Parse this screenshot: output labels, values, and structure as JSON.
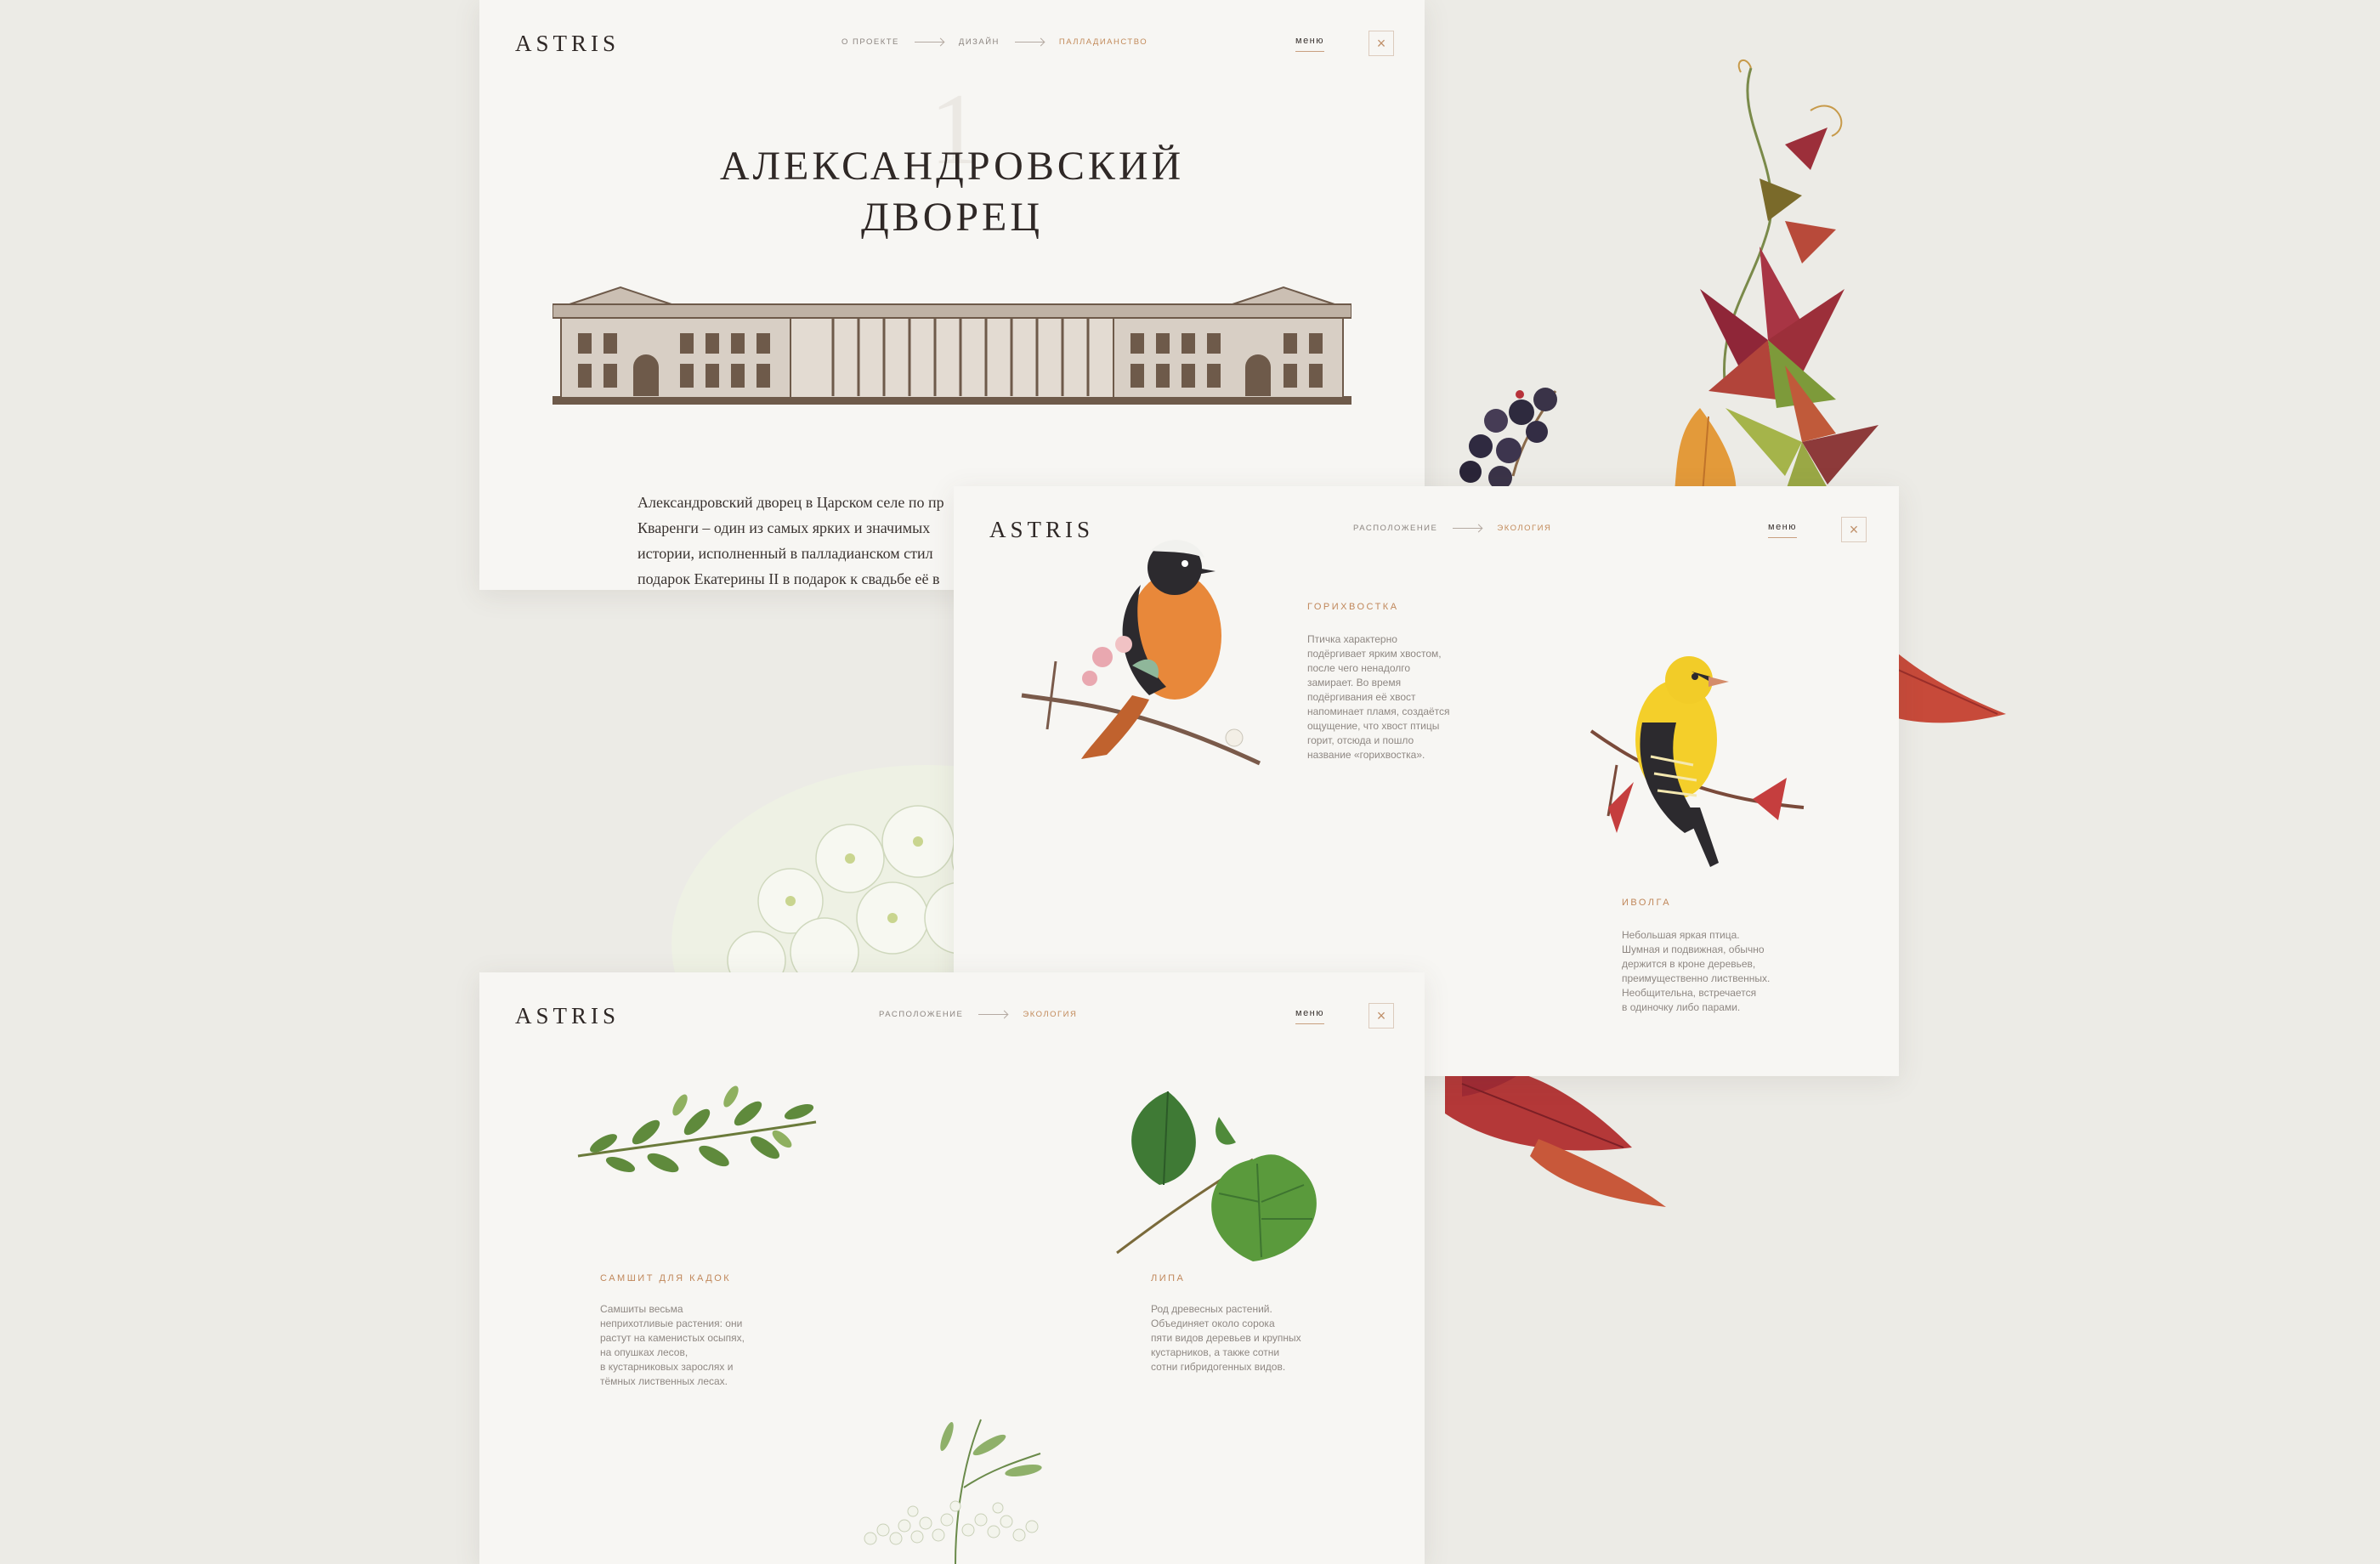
{
  "colors": {
    "background": "#ecebe6",
    "panel": "#f7f6f3",
    "accent": "#c28a5a",
    "text": "#3a3330"
  },
  "palace_page": {
    "logo": "ASTRIS",
    "breadcrumbs": [
      "о проекте",
      "дизайн",
      "палладианство"
    ],
    "menu_label": "меню",
    "close_icon": "close-icon",
    "chapter_number": "1",
    "title_line1": "АЛЕКСАНДРОВСКИЙ",
    "title_line2": "ДВОРЕЦ",
    "intro_lines": [
      "Александровский дворец в Царском селе по пр",
      "Кваренги – один из самых ярких и значимых",
      "истории, исполненный в палладианском стил",
      "подарок Екатерины II в подарок к свадьбе её в"
    ]
  },
  "birds_page": {
    "logo": "ASTRIS",
    "breadcrumbs": [
      "расположение",
      "экология"
    ],
    "menu_label": "меню",
    "close_icon": "close-icon",
    "redstart": {
      "title": "ГОРИХВОСТКА",
      "lines": [
        "Птичка характерно",
        "подёргивает ярким хвостом,",
        "после чего ненадолго",
        "замирает. Во время",
        "подёргивания её хвост",
        "напоминает пламя, создаётся",
        "ощущение, что хвост птицы",
        "горит, отсюда и пошло",
        "название «горихвостка»."
      ]
    },
    "oriole": {
      "title": "ИВОЛГА",
      "lines": [
        "Небольшая яркая птица.",
        "Шумная и подвижная, обычно",
        "держится в кроне деревьев,",
        "преимущественно лиственных.",
        "Необщительна, встречается",
        "в одиночку либо парами."
      ]
    }
  },
  "plants_page": {
    "logo": "ASTRIS",
    "breadcrumbs": [
      "расположение",
      "экология"
    ],
    "menu_label": "меню",
    "close_icon": "close-icon",
    "boxwood": {
      "title": "САМШИТ ДЛЯ КАДОК",
      "lines": [
        "Самшиты весьма",
        "неприхотливые растения: они",
        "растут на каменистых осыпях,",
        "на опушках лесов,",
        "в кустарниковых зарослях и",
        "тёмных лиственных лесах."
      ]
    },
    "linden": {
      "title": "ЛИПА",
      "lines": [
        "Род древесных растений.",
        "Объединяет около сорока",
        "пяти видов деревьев и крупных",
        "кустарников, а также сотни",
        "сотни гибридогенных видов."
      ]
    }
  }
}
